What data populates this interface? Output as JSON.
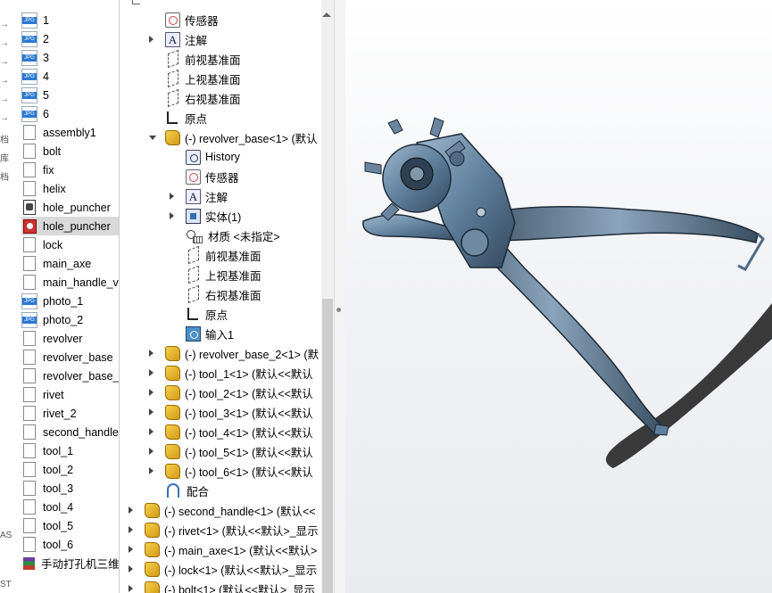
{
  "explorer": {
    "edge_chars": [
      "→",
      "→",
      "→",
      "→",
      "→",
      "→",
      "档",
      "库",
      "档",
      "AS",
      "ST"
    ],
    "files": [
      {
        "name": "1",
        "icon": "jpg-icon"
      },
      {
        "name": "2",
        "icon": "jpg-icon"
      },
      {
        "name": "3",
        "icon": "jpg-icon"
      },
      {
        "name": "4",
        "icon": "jpg-icon"
      },
      {
        "name": "5",
        "icon": "jpg-icon"
      },
      {
        "name": "6",
        "icon": "jpg-icon"
      },
      {
        "name": "assembly1",
        "icon": "file-icon"
      },
      {
        "name": "bolt",
        "icon": "file-icon"
      },
      {
        "name": "fix",
        "icon": "file-icon"
      },
      {
        "name": "helix",
        "icon": "file-icon"
      },
      {
        "name": "hole_puncher",
        "icon": "assembly-file-icon"
      },
      {
        "name": "hole_puncher",
        "icon": "drawing-file-icon",
        "selected": true
      },
      {
        "name": "lock",
        "icon": "file-icon"
      },
      {
        "name": "main_axe",
        "icon": "file-icon"
      },
      {
        "name": "main_handle_v",
        "icon": "file-icon"
      },
      {
        "name": "photo_1",
        "icon": "jpg-icon"
      },
      {
        "name": "photo_2",
        "icon": "jpg-icon"
      },
      {
        "name": "revolver",
        "icon": "file-icon"
      },
      {
        "name": "revolver_base",
        "icon": "file-icon"
      },
      {
        "name": "revolver_base_",
        "icon": "file-icon"
      },
      {
        "name": "rivet",
        "icon": "file-icon"
      },
      {
        "name": "rivet_2",
        "icon": "file-icon"
      },
      {
        "name": "second_handle",
        "icon": "file-icon"
      },
      {
        "name": "tool_1",
        "icon": "file-icon"
      },
      {
        "name": "tool_2",
        "icon": "file-icon"
      },
      {
        "name": "tool_3",
        "icon": "file-icon"
      },
      {
        "name": "tool_4",
        "icon": "file-icon"
      },
      {
        "name": "tool_5",
        "icon": "file-icon"
      },
      {
        "name": "tool_6",
        "icon": "file-icon"
      },
      {
        "name": "手动打孔机三维",
        "icon": "rar-icon"
      }
    ]
  },
  "feature_tree": {
    "items": [
      {
        "label": "传感器",
        "icon": "sensor-icon",
        "level": 1,
        "caret": "none"
      },
      {
        "label": "注解",
        "icon": "annotation-icon",
        "level": 1,
        "caret": "collapsed"
      },
      {
        "label": "前视基准面",
        "icon": "plane-icon",
        "level": 1,
        "caret": "none"
      },
      {
        "label": "上视基准面",
        "icon": "plane-icon",
        "level": 1,
        "caret": "none"
      },
      {
        "label": "右视基准面",
        "icon": "plane-icon",
        "level": 1,
        "caret": "none"
      },
      {
        "label": "原点",
        "icon": "origin-icon",
        "level": 1,
        "caret": "none"
      },
      {
        "label": "(-) revolver_base<1> (默认",
        "icon": "part-icon",
        "level": 1,
        "caret": "expanded"
      },
      {
        "label": "History",
        "icon": "history-icon",
        "level": 2,
        "caret": "none"
      },
      {
        "label": "传感器",
        "icon": "sensor-icon",
        "level": 2,
        "caret": "none"
      },
      {
        "label": "注解",
        "icon": "annotation-icon",
        "level": 2,
        "caret": "collapsed"
      },
      {
        "label": "实体(1)",
        "icon": "solid-body-icon",
        "level": 2,
        "caret": "collapsed"
      },
      {
        "label": "材质 <未指定>",
        "icon": "material-icon",
        "level": 2,
        "caret": "none"
      },
      {
        "label": "前视基准面",
        "icon": "plane-icon",
        "level": 2,
        "caret": "none"
      },
      {
        "label": "上视基准面",
        "icon": "plane-icon",
        "level": 2,
        "caret": "none"
      },
      {
        "label": "右视基准面",
        "icon": "plane-icon",
        "level": 2,
        "caret": "none"
      },
      {
        "label": "原点",
        "icon": "origin-icon",
        "level": 2,
        "caret": "none"
      },
      {
        "label": "输入1",
        "icon": "import-icon",
        "level": 2,
        "caret": "none"
      },
      {
        "label": "(-) revolver_base_2<1> (默",
        "icon": "part-icon",
        "level": 1,
        "caret": "collapsed"
      },
      {
        "label": "(-) tool_1<1> (默认<<默认",
        "icon": "part-icon",
        "level": 1,
        "caret": "collapsed"
      },
      {
        "label": "(-) tool_2<1> (默认<<默认",
        "icon": "part-icon",
        "level": 1,
        "caret": "collapsed"
      },
      {
        "label": "(-) tool_3<1> (默认<<默认",
        "icon": "part-icon",
        "level": 1,
        "caret": "collapsed"
      },
      {
        "label": "(-) tool_4<1> (默认<<默认",
        "icon": "part-icon",
        "level": 1,
        "caret": "collapsed"
      },
      {
        "label": "(-) tool_5<1> (默认<<默认",
        "icon": "part-icon",
        "level": 1,
        "caret": "collapsed"
      },
      {
        "label": "(-) tool_6<1> (默认<<默认",
        "icon": "part-icon",
        "level": 1,
        "caret": "collapsed"
      },
      {
        "label": "配合",
        "icon": "mate-icon",
        "level": 1,
        "caret": "none"
      },
      {
        "label": "(-) second_handle<1> (默认<<",
        "icon": "part-icon",
        "level": 0,
        "caret": "collapsed"
      },
      {
        "label": "(-) rivet<1> (默认<<默认>_显示",
        "icon": "part-icon",
        "level": 0,
        "caret": "collapsed"
      },
      {
        "label": "(-) main_axe<1> (默认<<默认>",
        "icon": "part-icon",
        "level": 0,
        "caret": "collapsed"
      },
      {
        "label": "(-) lock<1> (默认<<默认>_显示",
        "icon": "part-icon",
        "level": 0,
        "caret": "collapsed"
      },
      {
        "label": "(-) bolt<1> (默认<<默认>_显示",
        "icon": "part-icon",
        "level": 0,
        "caret": "collapsed"
      }
    ]
  },
  "viewport": {
    "model_name": "hole_puncher",
    "model_color": "#5a7a96",
    "background_top": "#ffffff",
    "background_bottom": "#e9ebef"
  }
}
